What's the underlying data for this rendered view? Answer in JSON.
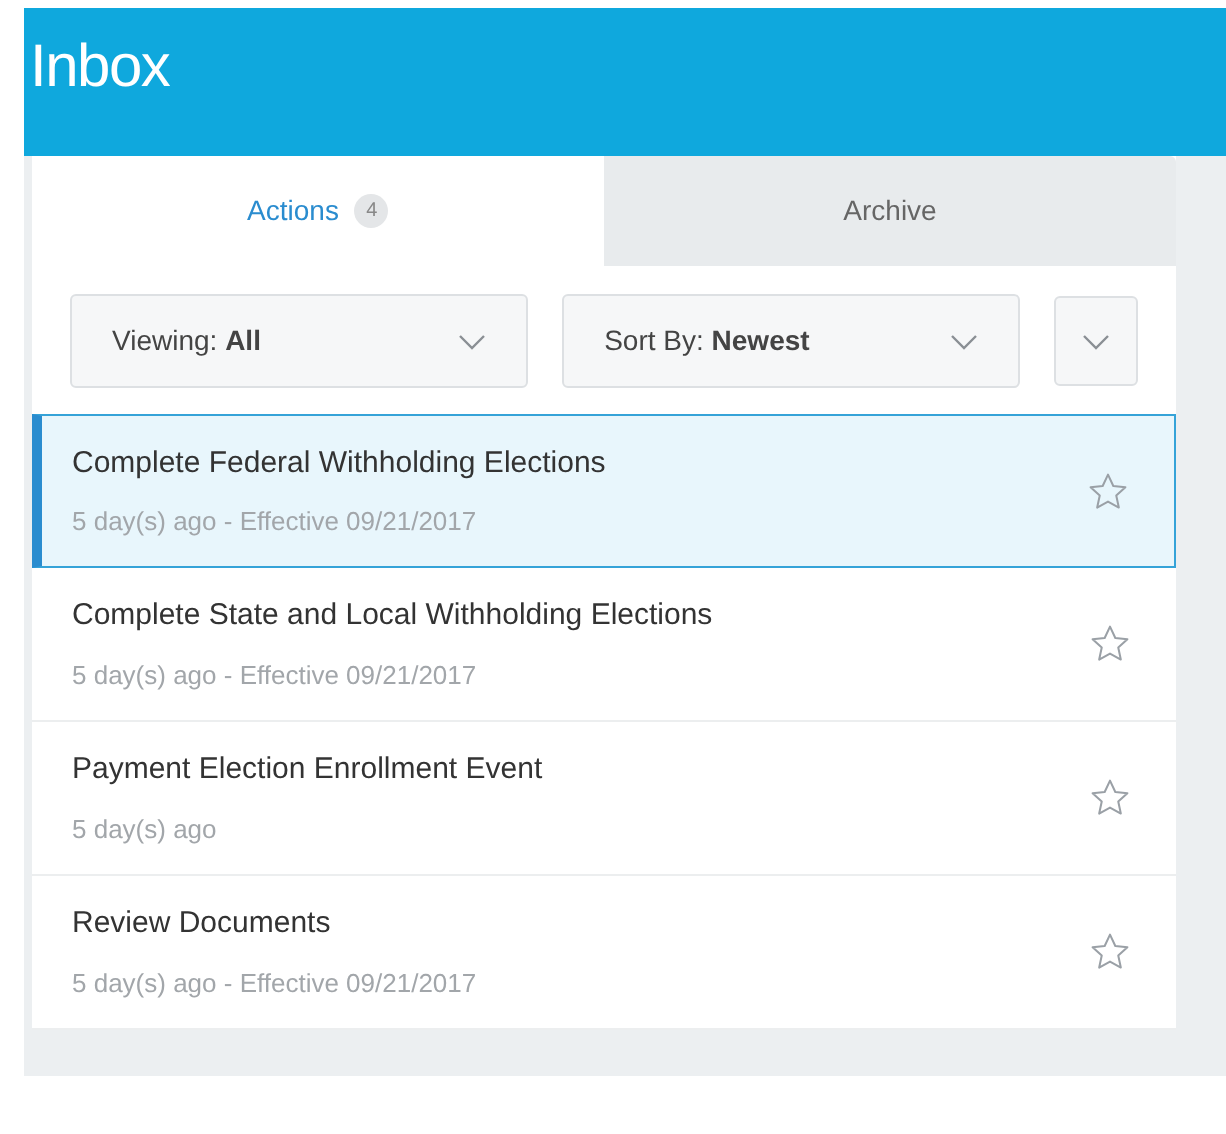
{
  "header": {
    "title": "Inbox"
  },
  "tabs": [
    {
      "label": "Actions",
      "count": "4",
      "selected": true
    },
    {
      "label": "Archive",
      "selected": false
    }
  ],
  "filters": [
    {
      "label": "Viewing: **All**"
    },
    {
      "label": "Sort By: **Newest**"
    }
  ],
  "items": [
    {
      "title": "Complete Federal Withholding Elections",
      "subtitle": "5 day(s) ago - Effective 09/21/2017",
      "selected": true
    },
    {
      "title": "Complete State and Local Withholding Elections",
      "subtitle": "5 day(s) ago - Effective 09/21/2017",
      "selected": false
    },
    {
      "title": "Payment Election Enrollment Event",
      "subtitle": "5 day(s) ago",
      "selected": false
    },
    {
      "title": "Review Documents",
      "subtitle": "5 day(s) ago - Effective 09/21/2017",
      "selected": false
    }
  ]
}
